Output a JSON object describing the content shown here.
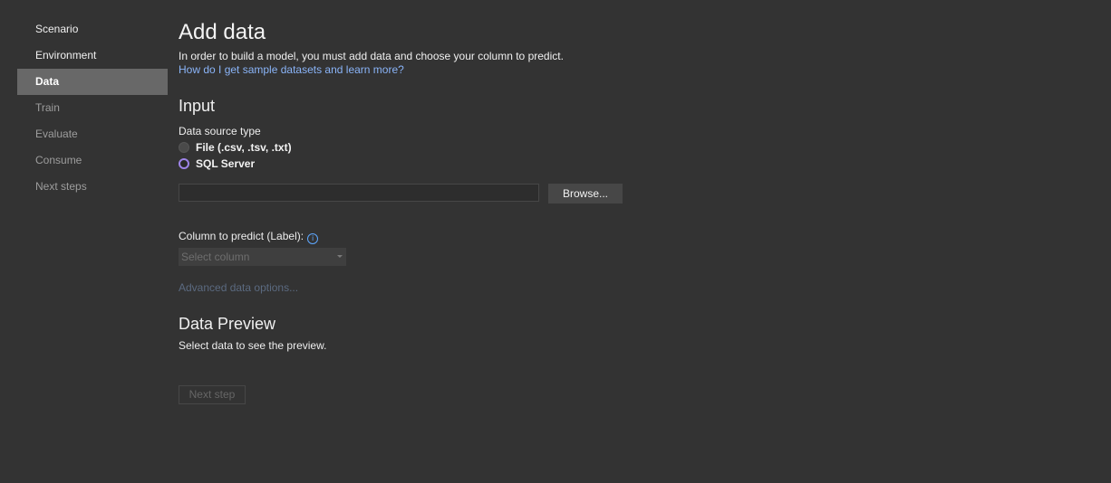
{
  "sidebar": {
    "items": [
      {
        "label": "Scenario"
      },
      {
        "label": "Environment"
      },
      {
        "label": "Data"
      },
      {
        "label": "Train"
      },
      {
        "label": "Evaluate"
      },
      {
        "label": "Consume"
      },
      {
        "label": "Next steps"
      }
    ]
  },
  "main": {
    "title": "Add data",
    "intro": "In order to build a model, you must add data and choose your column to predict.",
    "help_link": "How do I get sample datasets and learn more?",
    "input": {
      "heading": "Input",
      "source_label": "Data source type",
      "options": [
        {
          "label": "File (.csv, .tsv, .txt)",
          "selected": false
        },
        {
          "label": "SQL Server",
          "selected": true
        }
      ],
      "path_value": "",
      "browse_label": "Browse..."
    },
    "label_column": {
      "label": "Column to predict (Label):",
      "info_icon": "info-icon",
      "select_placeholder": "Select column"
    },
    "advanced_link": "Advanced data options...",
    "preview": {
      "heading": "Data Preview",
      "text": "Select data to see the preview."
    },
    "next_label": "Next step"
  },
  "colors": {
    "background": "#333333",
    "active_nav": "#686868",
    "link": "#8ab4f8",
    "radio_selected": "#9e84e8"
  }
}
